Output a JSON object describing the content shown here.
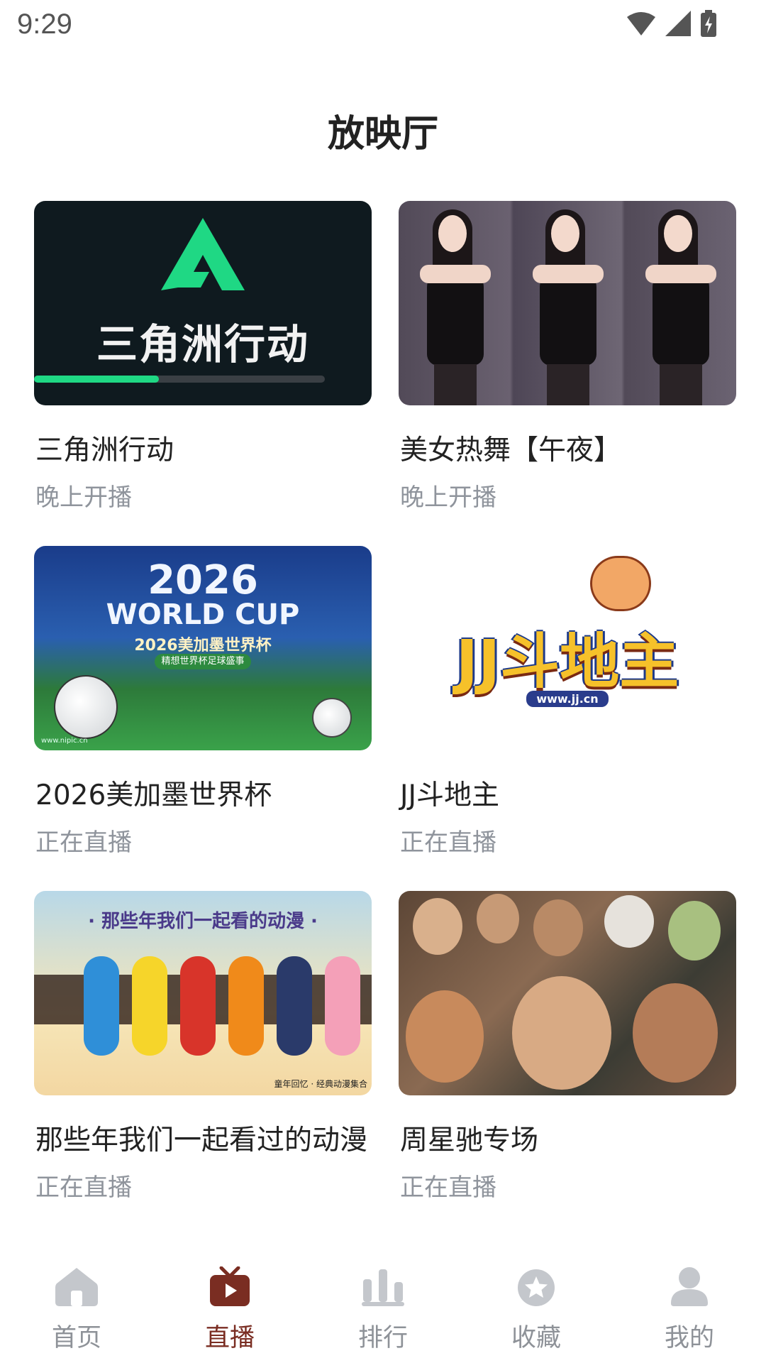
{
  "status_bar": {
    "time": "9:29"
  },
  "page": {
    "title": "放映厅"
  },
  "cards": [
    {
      "title": "三角洲行动",
      "status": "晚上开播",
      "thumb_text": "三角洲行动"
    },
    {
      "title": "美女热舞【午夜】",
      "status": "晚上开播"
    },
    {
      "title": "2026美加墨世界杯",
      "status": "正在直播",
      "thumb_year": "2026",
      "thumb_wc": "WORLD CUP",
      "thumb_zh": "2026美加墨世界杯",
      "thumb_pill": "精想世界杯足球盛事",
      "thumb_wm": "www.nipic.cn"
    },
    {
      "title": "JJ斗地主",
      "status": "正在直播",
      "thumb_logo": "JJ斗地主",
      "thumb_url": "www.jj.cn"
    },
    {
      "title": "那些年我们一起看过的动漫",
      "status": "正在直播",
      "thumb_title": "· 那些年我们一起看的动漫 ·",
      "thumb_foot": "童年回忆 · 经典动漫集合"
    },
    {
      "title": "周星驰专场",
      "status": "正在直播"
    }
  ],
  "tabs": [
    {
      "label": "首页",
      "icon": "home-icon"
    },
    {
      "label": "直播",
      "icon": "tv-play-icon"
    },
    {
      "label": "排行",
      "icon": "bar-chart-icon"
    },
    {
      "label": "收藏",
      "icon": "star-icon"
    },
    {
      "label": "我的",
      "icon": "person-icon"
    }
  ],
  "colors": {
    "active_tab": "#7a2d22",
    "inactive_tab": "#c4c7cc",
    "subtext": "#8f949c",
    "delta_accent": "#1fd884"
  }
}
